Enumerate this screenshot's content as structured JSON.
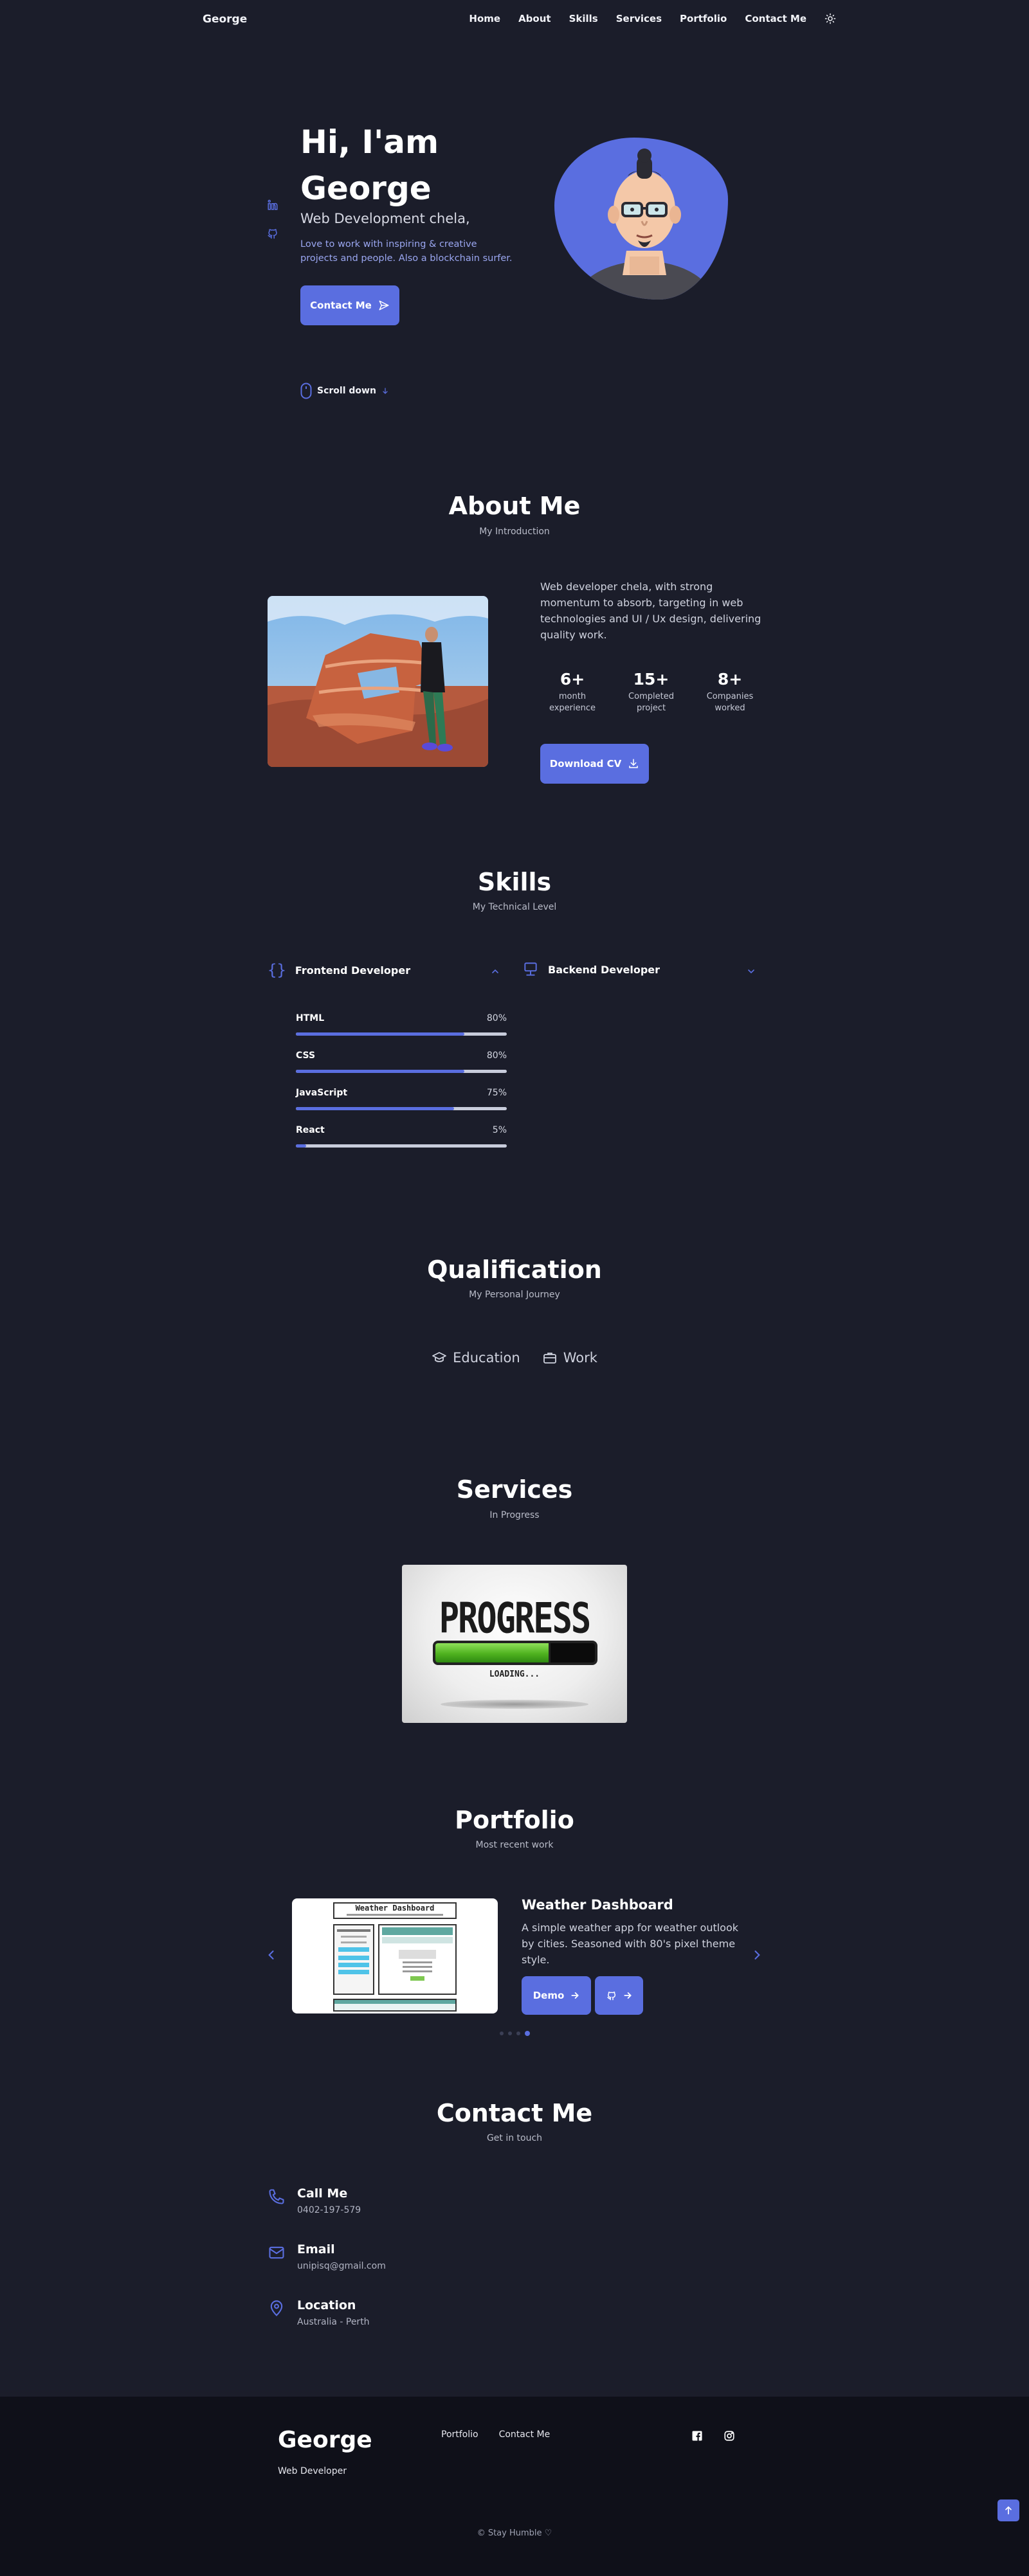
{
  "header": {
    "logo": "George",
    "nav": [
      "Home",
      "About",
      "Skills",
      "Services",
      "Portfolio",
      "Contact Me"
    ]
  },
  "hero": {
    "title_line1": "Hi, I'am",
    "title_line2": "George",
    "subtitle": "Web Development chela,",
    "description": "Love to work with inspiring & creative projects and people. Also a blockchain surfer.",
    "contact_button": "Contact Me",
    "scroll_label": "Scroll down"
  },
  "about": {
    "title": "About Me",
    "subtitle": "My Introduction",
    "description": "Web developer chela, with strong momentum to absorb, targeting in web technologies and UI / Ux design, delivering quality work.",
    "stats": [
      {
        "number": "6+",
        "label": "month experience"
      },
      {
        "number": "15+",
        "label": "Completed project"
      },
      {
        "number": "8+",
        "label": "Companies worked"
      }
    ],
    "cv_button": "Download CV"
  },
  "skills": {
    "title": "Skills",
    "subtitle": "My Technical Level",
    "frontend_label": "Frontend Developer",
    "backend_label": "Backend Developer",
    "items": [
      {
        "name": "HTML",
        "percent_label": "80%",
        "value": 80
      },
      {
        "name": "CSS",
        "percent_label": "80%",
        "value": 80
      },
      {
        "name": "JavaScript",
        "percent_label": "75%",
        "value": 75
      },
      {
        "name": "React",
        "percent_label": "5%",
        "value": 5
      }
    ]
  },
  "qualification": {
    "title": "Qualification",
    "subtitle": "My Personal Journey",
    "tabs": [
      "Education",
      "Work"
    ]
  },
  "services": {
    "title": "Services",
    "subtitle": "In Progress",
    "card_heading": "PROGRESS",
    "card_caption": "LOADING...",
    "card_progress": 0.72
  },
  "portfolio": {
    "title": "Portfolio",
    "subtitle": "Most recent work",
    "project_title": "Weather Dashboard",
    "project_desc": "A simple weather app for weather outlook by cities. Seasoned with 80's pixel theme style.",
    "demo_button": "Demo",
    "thumb_title": "Weather Dashboard",
    "slides": 4,
    "active_slide": 4
  },
  "contact": {
    "title": "Contact Me",
    "subtitle": "Get in touch",
    "items": [
      {
        "title": "Call Me",
        "value": "0402-197-579"
      },
      {
        "title": "Email",
        "value": "unipisq@gmail.com"
      },
      {
        "title": "Location",
        "value": "Australia - Perth"
      }
    ]
  },
  "footer": {
    "name": "George",
    "role": "Web Developer",
    "links": [
      "Portfolio",
      "Contact Me"
    ],
    "copyright": "© Stay Humble ♡"
  },
  "colors": {
    "background": "#1b1d2a",
    "accent": "#5a6ee0",
    "footer": "#0f1019"
  }
}
